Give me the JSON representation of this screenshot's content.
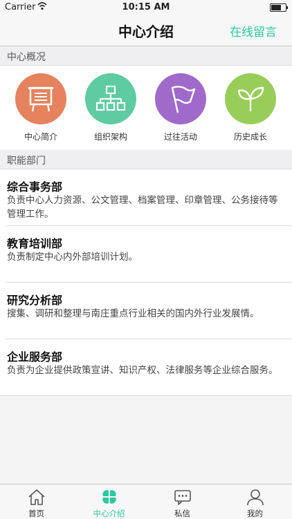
{
  "status_bar": {
    "carrier": "Carrier",
    "time": "10:15 AM",
    "battery_level": 0.7
  },
  "nav": {
    "title": "中心介绍",
    "right_action": "在线留言"
  },
  "overview": {
    "header": "中心概况",
    "items": [
      {
        "label": "中心简介",
        "icon": "presentation-board-icon",
        "color": "#e5835e"
      },
      {
        "label": "组织架构",
        "icon": "org-chart-icon",
        "color": "#5fcba1"
      },
      {
        "label": "过往活动",
        "icon": "flag-icon",
        "color": "#a06acb"
      },
      {
        "label": "历史成长",
        "icon": "sprout-icon",
        "color": "#99cd5a"
      }
    ]
  },
  "departments": {
    "header": "职能部门",
    "items": [
      {
        "name": "综合事务部",
        "desc": "负责中心人力资源、公文管理、档案管理、印章管理、公务接待等管理工作。"
      },
      {
        "name": "教育培训部",
        "desc": "负责制定中心内外部培训计划。"
      },
      {
        "name": "研究分析部",
        "desc": "搜集、调研和整理与南庄重点行业相关的国内外行业发展情。"
      },
      {
        "name": "企业服务部",
        "desc": "负责为企业提供政策宣讲、知识产权、法律服务等企业综合服务。"
      }
    ]
  },
  "tabs": [
    {
      "label": "首页",
      "icon": "home-icon",
      "active": false
    },
    {
      "label": "中心介绍",
      "icon": "clover-icon",
      "active": true
    },
    {
      "label": "私信",
      "icon": "chat-icon",
      "active": false
    },
    {
      "label": "我的",
      "icon": "person-icon",
      "active": false
    }
  ],
  "colors": {
    "accent": "#2bc8a0"
  }
}
